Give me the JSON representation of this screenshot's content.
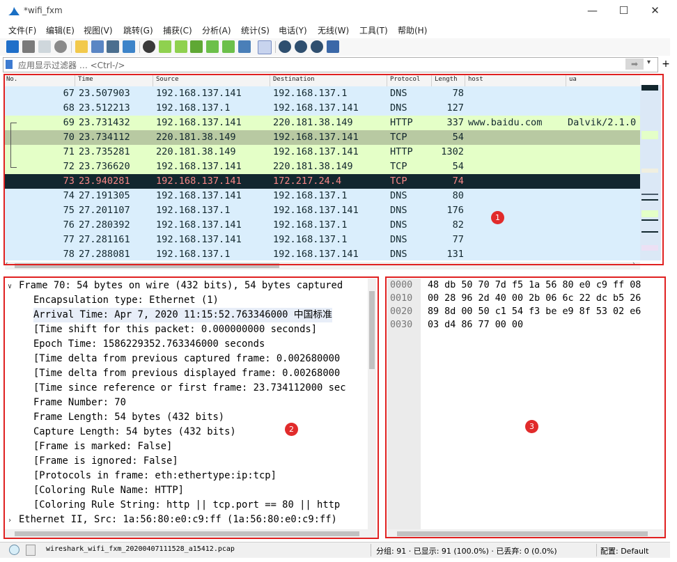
{
  "window": {
    "title": "*wifi_fxm",
    "minimize": "—",
    "maximize": "☐",
    "close": "✕"
  },
  "menu": [
    "文件(F)",
    "编辑(E)",
    "视图(V)",
    "跳转(G)",
    "捕获(C)",
    "分析(A)",
    "统计(S)",
    "电话(Y)",
    "无线(W)",
    "工具(T)",
    "帮助(H)"
  ],
  "filter": {
    "placeholder": "应用显示过滤器 … <Ctrl-/>",
    "apply_arrow": "➡"
  },
  "packet_list": {
    "columns": {
      "no": "No.",
      "time": "Time",
      "source": "Source",
      "destination": "Destination",
      "protocol": "Protocol",
      "length": "Length",
      "host": "host",
      "ua": "ua"
    },
    "rows": [
      {
        "no": "67",
        "time": "23.507903",
        "source": "192.168.137.141",
        "destination": "192.168.137.1",
        "protocol": "DNS",
        "length": "78",
        "host": "",
        "ua": "",
        "style": "dns"
      },
      {
        "no": "68",
        "time": "23.512213",
        "source": "192.168.137.1",
        "destination": "192.168.137.141",
        "protocol": "DNS",
        "length": "127",
        "host": "",
        "ua": "",
        "style": "dns"
      },
      {
        "no": "69",
        "time": "23.731432",
        "source": "192.168.137.141",
        "destination": "220.181.38.149",
        "protocol": "HTTP",
        "length": "337",
        "host": "www.baidu.com",
        "ua": "Dalvik/2.1.0",
        "style": "http"
      },
      {
        "no": "70",
        "time": "23.734112",
        "source": "220.181.38.149",
        "destination": "192.168.137.141",
        "protocol": "TCP",
        "length": "54",
        "host": "",
        "ua": "",
        "style": "selected"
      },
      {
        "no": "71",
        "time": "23.735281",
        "source": "220.181.38.149",
        "destination": "192.168.137.141",
        "protocol": "HTTP",
        "length": "1302",
        "host": "",
        "ua": "",
        "style": "http"
      },
      {
        "no": "72",
        "time": "23.736620",
        "source": "192.168.137.141",
        "destination": "220.181.38.149",
        "protocol": "TCP",
        "length": "54",
        "host": "",
        "ua": "",
        "style": "http"
      },
      {
        "no": "73",
        "time": "23.940281",
        "source": "192.168.137.141",
        "destination": "172.217.24.4",
        "protocol": "TCP",
        "length": "74",
        "host": "",
        "ua": "",
        "style": "bad"
      },
      {
        "no": "74",
        "time": "27.191305",
        "source": "192.168.137.141",
        "destination": "192.168.137.1",
        "protocol": "DNS",
        "length": "80",
        "host": "",
        "ua": "",
        "style": "dns"
      },
      {
        "no": "75",
        "time": "27.201107",
        "source": "192.168.137.1",
        "destination": "192.168.137.141",
        "protocol": "DNS",
        "length": "176",
        "host": "",
        "ua": "",
        "style": "dns"
      },
      {
        "no": "76",
        "time": "27.280392",
        "source": "192.168.137.141",
        "destination": "192.168.137.1",
        "protocol": "DNS",
        "length": "82",
        "host": "",
        "ua": "",
        "style": "dns"
      },
      {
        "no": "77",
        "time": "27.281161",
        "source": "192.168.137.141",
        "destination": "192.168.137.1",
        "protocol": "DNS",
        "length": "77",
        "host": "",
        "ua": "",
        "style": "dns"
      },
      {
        "no": "78",
        "time": "27.288081",
        "source": "192.168.137.1",
        "destination": "192.168.137.141",
        "protocol": "DNS",
        "length": "131",
        "host": "",
        "ua": "",
        "style": "dns"
      }
    ]
  },
  "details": {
    "lines": [
      {
        "text": "Frame 70: 54 bytes on wire (432 bits), 54 bytes captured",
        "indent": 0,
        "toggle": "down"
      },
      {
        "text": "Encapsulation type: Ethernet (1)",
        "indent": 1
      },
      {
        "text": "Arrival Time: Apr  7, 2020 11:15:52.763346000 中国标准",
        "indent": 1
      },
      {
        "text": "[Time shift for this packet: 0.000000000 seconds]",
        "indent": 1
      },
      {
        "text": "Epoch Time: 1586229352.763346000 seconds",
        "indent": 1
      },
      {
        "text": "[Time delta from previous captured frame: 0.002680000",
        "indent": 1
      },
      {
        "text": "[Time delta from previous displayed frame: 0.00268000",
        "indent": 1
      },
      {
        "text": "[Time since reference or first frame: 23.734112000 sec",
        "indent": 1
      },
      {
        "text": "Frame Number: 70",
        "indent": 1
      },
      {
        "text": "Frame Length: 54 bytes (432 bits)",
        "indent": 1
      },
      {
        "text": "Capture Length: 54 bytes (432 bits)",
        "indent": 1
      },
      {
        "text": "[Frame is marked: False]",
        "indent": 1
      },
      {
        "text": "[Frame is ignored: False]",
        "indent": 1
      },
      {
        "text": "[Protocols in frame: eth:ethertype:ip:tcp]",
        "indent": 1
      },
      {
        "text": "[Coloring Rule Name: HTTP]",
        "indent": 1
      },
      {
        "text": "[Coloring Rule String: http || tcp.port == 80 || http",
        "indent": 1
      },
      {
        "text": "Ethernet II, Src: 1a:56:80:e0:c9:ff (1a:56:80:e0:c9:ff)",
        "indent": 0,
        "toggle": "right"
      }
    ]
  },
  "bytes": {
    "rows": [
      {
        "offset": "0000",
        "hex": "48 db 50 70 7d f5 1a 56  80 e0 c9 ff 08"
      },
      {
        "offset": "0010",
        "hex": "00 28 96 2d 40 00 2b 06  6c 22 dc b5 26"
      },
      {
        "offset": "0020",
        "hex": "89 8d 00 50 c1 54 f3 be  e9 8f 53 02 e6"
      },
      {
        "offset": "0030",
        "hex": "03 d4 86 77 00 00"
      }
    ]
  },
  "status": {
    "filename": "wireshark_wifi_fxm_20200407111528_a15412.pcap",
    "packets": "分组: 91 · 已显示: 91 (100.0%) · 已丢弃: 0 (0.0%)",
    "profile": "配置: Default"
  },
  "annotations": {
    "badge1": "1",
    "badge2": "2",
    "badge3": "3"
  },
  "colors": {
    "dns_bg": "#daeefc",
    "http_bg": "#e4ffc7",
    "selected_bg": "#b8c9a2",
    "bad_bg": "#12272e",
    "bad_fg": "#f78787",
    "annotation_red": "#e02020"
  }
}
